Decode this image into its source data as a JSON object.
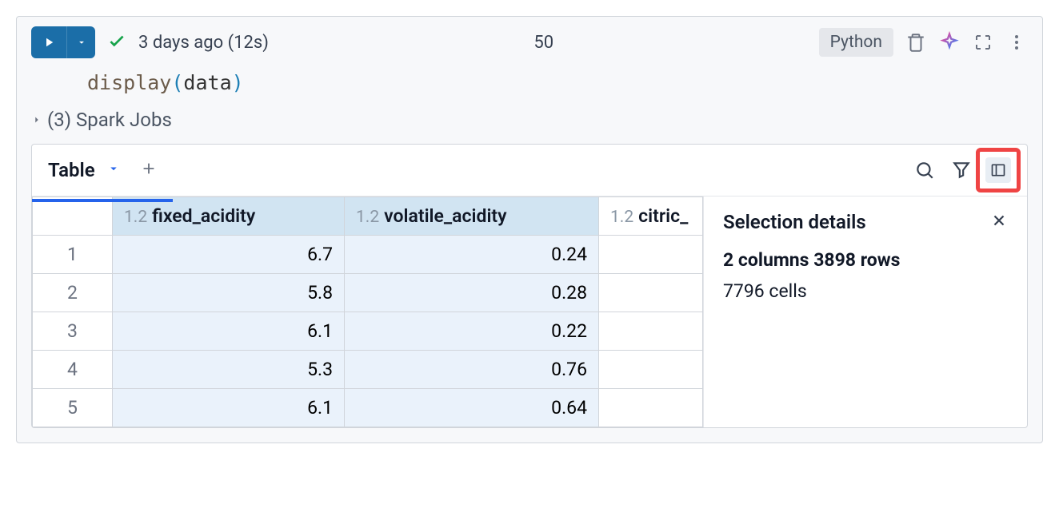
{
  "toolbar": {
    "status_text": "3 days ago (12s)",
    "cell_number": "50",
    "lang_badge": "Python"
  },
  "code": {
    "fn": "display",
    "lparen": "(",
    "var": "data",
    "rparen": ")"
  },
  "jobs": {
    "label": "(3) Spark Jobs"
  },
  "output": {
    "tab_label": "Table",
    "columns": [
      {
        "type_prefix": "1.2",
        "name": "fixed_acidity",
        "selected": true
      },
      {
        "type_prefix": "1.2",
        "name": "volatile_acidity",
        "selected": true
      },
      {
        "type_prefix": "1.2",
        "name": "citric_",
        "selected": false
      }
    ],
    "rows": [
      {
        "idx": "1",
        "vals": [
          "6.7",
          "0.24",
          ""
        ]
      },
      {
        "idx": "2",
        "vals": [
          "5.8",
          "0.28",
          ""
        ]
      },
      {
        "idx": "3",
        "vals": [
          "6.1",
          "0.22",
          ""
        ]
      },
      {
        "idx": "4",
        "vals": [
          "5.3",
          "0.76",
          ""
        ]
      },
      {
        "idx": "5",
        "vals": [
          "6.1",
          "0.64",
          ""
        ]
      }
    ]
  },
  "selection": {
    "title": "Selection details",
    "summary_bold": "2 columns 3898 rows",
    "cells_line": "7796 cells"
  },
  "chart_data": {
    "type": "table",
    "columns": [
      "fixed_acidity",
      "volatile_acidity"
    ],
    "rows": [
      [
        6.7,
        0.24
      ],
      [
        5.8,
        0.28
      ],
      [
        6.1,
        0.22
      ],
      [
        5.3,
        0.76
      ],
      [
        6.1,
        0.64
      ]
    ]
  }
}
